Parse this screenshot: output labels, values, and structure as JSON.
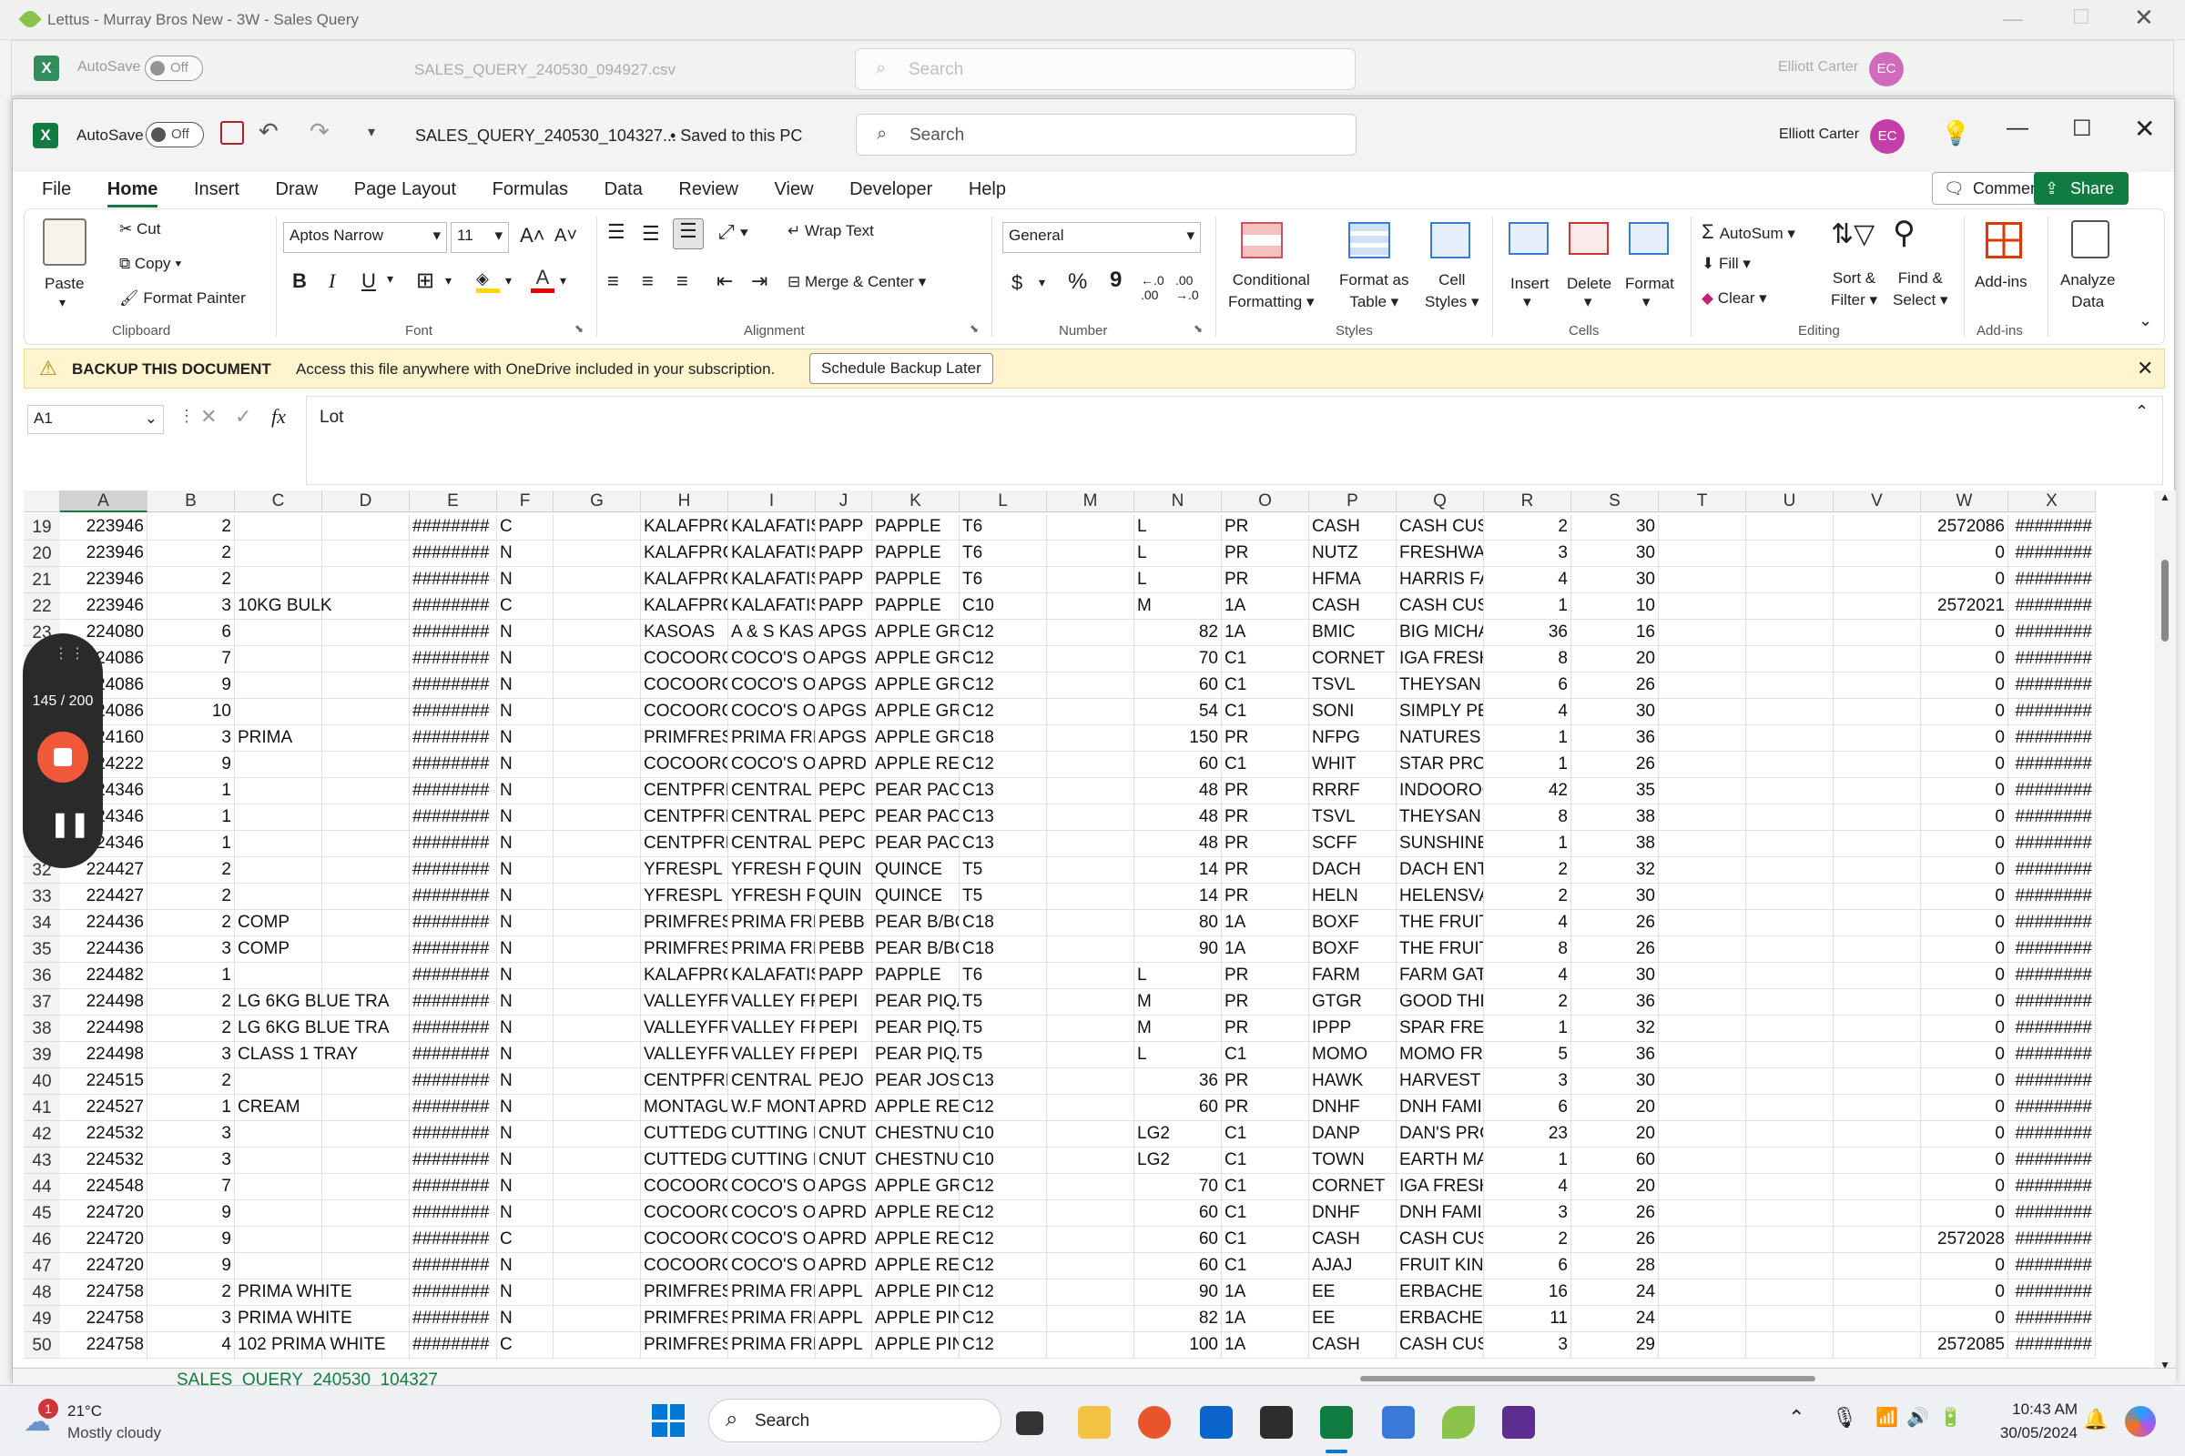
{
  "outer_window": {
    "title": "Lettus - Murray Bros New - 3W - Sales Query"
  },
  "background_window": {
    "autosave_label": "AutoSave",
    "toggle_state": "Off",
    "file_name": "SALES_QUERY_240530_094927.csv",
    "search_placeholder": "Search",
    "user_name": "Elliott Carter",
    "user_initials": "EC"
  },
  "window": {
    "autosave_label": "AutoSave",
    "toggle_state": "Off",
    "file_name": "SALES_QUERY_240530_104327...",
    "save_status": "• Saved to this PC",
    "search_placeholder": "Search",
    "user_name": "Elliott Carter",
    "user_initials": "EC"
  },
  "menu": [
    "File",
    "Home",
    "Insert",
    "Draw",
    "Page Layout",
    "Formulas",
    "Data",
    "Review",
    "View",
    "Developer",
    "Help"
  ],
  "menu_active": "Home",
  "comments_label": "Comments",
  "share_label": "Share",
  "ribbon": {
    "clipboard": {
      "paste": "Paste",
      "cut": "Cut",
      "copy": "Copy",
      "format_painter": "Format Painter",
      "group": "Clipboard"
    },
    "font": {
      "name": "Aptos Narrow",
      "size": "11",
      "group": "Font",
      "bold": "B",
      "italic": "I",
      "underline": "U"
    },
    "alignment": {
      "wrap_text": "Wrap Text",
      "merge_center": "Merge & Center",
      "group": "Alignment"
    },
    "number": {
      "format": "General",
      "group": "Number",
      "currency": "$",
      "percent": "%",
      "comma": "9"
    },
    "styles": {
      "conditional_1": "Conditional",
      "conditional_2": "Formatting",
      "format_table_1": "Format as",
      "format_table_2": "Table",
      "cell_styles_1": "Cell",
      "cell_styles_2": "Styles",
      "group": "Styles"
    },
    "cells": {
      "insert": "Insert",
      "delete": "Delete",
      "format": "Format",
      "group": "Cells"
    },
    "editing": {
      "autosum": "AutoSum",
      "fill": "Fill",
      "clear": "Clear",
      "sort_1": "Sort &",
      "sort_2": "Filter",
      "find_1": "Find &",
      "find_2": "Select",
      "group": "Editing"
    },
    "addins": {
      "addins": "Add-ins",
      "group": "Add-ins",
      "analyze_1": "Analyze",
      "analyze_2": "Data"
    }
  },
  "message_bar": {
    "title": "BACKUP THIS DOCUMENT",
    "text": "Access this file anywhere with OneDrive included in your subscription.",
    "button": "Schedule Backup Later"
  },
  "formula_bar": {
    "name_box": "A1",
    "fx": "fx",
    "content": "Lot"
  },
  "columns": [
    "A",
    "B",
    "C",
    "D",
    "E",
    "F",
    "G",
    "H",
    "I",
    "J",
    "K",
    "L",
    "M",
    "N",
    "O",
    "P",
    "Q",
    "R",
    "S",
    "T",
    "U",
    "V",
    "W",
    "X"
  ],
  "rows": [
    {
      "n": "19",
      "A": "223946",
      "B": "2",
      "C": "",
      "E": "########",
      "F": "C",
      "H": "KALAFPRC",
      "I": "KALAFATIS",
      "J": "PAPP",
      "K": "PAPPLE",
      "L": "T6",
      "M": "",
      "Nt": "L",
      "Nn": "",
      "O": "PR",
      "P": "CASH",
      "Q": "CASH CUS",
      "R": "2",
      "S": "30",
      "W": "2572086",
      "X": "########"
    },
    {
      "n": "20",
      "A": "223946",
      "B": "2",
      "C": "",
      "E": "########",
      "F": "N",
      "H": "KALAFPRC",
      "I": "KALAFATIS",
      "J": "PAPP",
      "K": "PAPPLE",
      "L": "T6",
      "M": "",
      "Nt": "L",
      "Nn": "",
      "O": "PR",
      "P": "NUTZ",
      "Q": "FRESHWAY",
      "R": "3",
      "S": "30",
      "W": "0",
      "X": "########"
    },
    {
      "n": "21",
      "A": "223946",
      "B": "2",
      "C": "",
      "E": "########",
      "F": "N",
      "H": "KALAFPRC",
      "I": "KALAFATIS",
      "J": "PAPP",
      "K": "PAPPLE",
      "L": "T6",
      "M": "",
      "Nt": "L",
      "Nn": "",
      "O": "PR",
      "P": "HFMA",
      "Q": "HARRIS FA",
      "R": "4",
      "S": "30",
      "W": "0",
      "X": "########"
    },
    {
      "n": "22",
      "A": "223946",
      "B": "3",
      "C": "10KG BULK",
      "E": "########",
      "F": "C",
      "H": "KALAFPRC",
      "I": "KALAFATIS",
      "J": "PAPP",
      "K": "PAPPLE",
      "L": "C10",
      "M": "",
      "Nt": "M",
      "Nn": "",
      "O": "1A",
      "P": "CASH",
      "Q": "CASH CUS",
      "R": "1",
      "S": "10",
      "W": "2572021",
      "X": "########"
    },
    {
      "n": "23",
      "A": "224080",
      "B": "6",
      "C": "",
      "E": "########",
      "F": "N",
      "H": "KASOAS",
      "I": "A & S KASC",
      "J": "APGS",
      "K": "APPLE GR/",
      "L": "C12",
      "M": "",
      "Nt": "",
      "Nn": "82",
      "O": "1A",
      "P": "BMIC",
      "Q": "BIG MICHA",
      "R": "36",
      "S": "16",
      "W": "0",
      "X": "########"
    },
    {
      "n": "24",
      "A": "224086",
      "B": "7",
      "C": "",
      "E": "########",
      "F": "N",
      "H": "COCOORC",
      "I": "COCO'S O",
      "J": "APGS",
      "K": "APPLE GR/",
      "L": "C12",
      "M": "",
      "Nt": "",
      "Nn": "70",
      "O": "C1",
      "P": "CORNET",
      "Q": "IGA FRESH",
      "R": "8",
      "S": "20",
      "W": "0",
      "X": "########"
    },
    {
      "n": "25",
      "A": "224086",
      "B": "9",
      "C": "",
      "E": "########",
      "F": "N",
      "H": "COCOORC",
      "I": "COCO'S O",
      "J": "APGS",
      "K": "APPLE GR/",
      "L": "C12",
      "M": "",
      "Nt": "",
      "Nn": "60",
      "O": "C1",
      "P": "TSVL",
      "Q": "THEYSAN L",
      "R": "6",
      "S": "26",
      "W": "0",
      "X": "########"
    },
    {
      "n": "26",
      "A": "224086",
      "B": "10",
      "C": "",
      "E": "########",
      "F": "N",
      "H": "COCOORC",
      "I": "COCO'S O",
      "J": "APGS",
      "K": "APPLE GR/",
      "L": "C12",
      "M": "",
      "Nt": "",
      "Nn": "54",
      "O": "C1",
      "P": "SONI",
      "Q": "SIMPLY PE",
      "R": "4",
      "S": "30",
      "W": "0",
      "X": "########"
    },
    {
      "n": "27",
      "A": "224160",
      "B": "3",
      "C": "PRIMA",
      "E": "########",
      "F": "N",
      "H": "PRIMFRES",
      "I": "PRIMA FRE",
      "J": "APGS",
      "K": "APPLE GR/",
      "L": "C18",
      "M": "",
      "Nt": "",
      "Nn": "150",
      "O": "PR",
      "P": "NFPG",
      "Q": "NATURES I",
      "R": "1",
      "S": "36",
      "W": "0",
      "X": "########"
    },
    {
      "n": "28",
      "A": "224222",
      "B": "9",
      "C": "",
      "E": "########",
      "F": "N",
      "H": "COCOORC",
      "I": "COCO'S O",
      "J": "APRD",
      "K": "APPLE REI",
      "L": "C12",
      "M": "",
      "Nt": "",
      "Nn": "60",
      "O": "C1",
      "P": "WHIT",
      "Q": "STAR PROI",
      "R": "1",
      "S": "26",
      "W": "0",
      "X": "########"
    },
    {
      "n": "29",
      "A": "224346",
      "B": "1",
      "C": "",
      "E": "########",
      "F": "N",
      "H": "CENTPFRE",
      "I": "CENTRAL I",
      "J": "PEPC",
      "K": "PEAR PACI",
      "L": "C13",
      "M": "",
      "Nt": "",
      "Nn": "48",
      "O": "PR",
      "P": "RRRF",
      "Q": "INDOOROO",
      "R": "42",
      "S": "35",
      "W": "0",
      "X": "########"
    },
    {
      "n": "30",
      "A": "224346",
      "B": "1",
      "C": "",
      "E": "########",
      "F": "N",
      "H": "CENTPFRE",
      "I": "CENTRAL I",
      "J": "PEPC",
      "K": "PEAR PACI",
      "L": "C13",
      "M": "",
      "Nt": "",
      "Nn": "48",
      "O": "PR",
      "P": "TSVL",
      "Q": "THEYSAN L",
      "R": "8",
      "S": "38",
      "W": "0",
      "X": "########"
    },
    {
      "n": "31",
      "A": "224346",
      "B": "1",
      "C": "",
      "E": "########",
      "F": "N",
      "H": "CENTPFRE",
      "I": "CENTRAL I",
      "J": "PEPC",
      "K": "PEAR PACI",
      "L": "C13",
      "M": "",
      "Nt": "",
      "Nn": "48",
      "O": "PR",
      "P": "SCFF",
      "Q": "SUNSHINE",
      "R": "1",
      "S": "38",
      "W": "0",
      "X": "########"
    },
    {
      "n": "32",
      "A": "224427",
      "B": "2",
      "C": "",
      "E": "########",
      "F": "N",
      "H": "YFRESPL",
      "I": "YFRESH P/",
      "J": "QUIN",
      "K": "QUINCE",
      "L": "T5",
      "M": "",
      "Nt": "",
      "Nn": "14",
      "O": "PR",
      "P": "DACH",
      "Q": "DACH ENT",
      "R": "2",
      "S": "32",
      "W": "0",
      "X": "########"
    },
    {
      "n": "33",
      "A": "224427",
      "B": "2",
      "C": "",
      "E": "########",
      "F": "N",
      "H": "YFRESPL",
      "I": "YFRESH P/",
      "J": "QUIN",
      "K": "QUINCE",
      "L": "T5",
      "M": "",
      "Nt": "",
      "Nn": "14",
      "O": "PR",
      "P": "HELN",
      "Q": "HELENSVA",
      "R": "2",
      "S": "30",
      "W": "0",
      "X": "########"
    },
    {
      "n": "34",
      "A": "224436",
      "B": "2",
      "C": "COMP",
      "E": "########",
      "F": "N",
      "H": "PRIMFRES",
      "I": "PRIMA FRE",
      "J": "PEBB",
      "K": "PEAR B/BC",
      "L": "C18",
      "M": "",
      "Nt": "",
      "Nn": "80",
      "O": "1A",
      "P": "BOXF",
      "Q": "THE FRUIT",
      "R": "4",
      "S": "26",
      "W": "0",
      "X": "########"
    },
    {
      "n": "35",
      "A": "224436",
      "B": "3",
      "C": "COMP",
      "E": "########",
      "F": "N",
      "H": "PRIMFRES",
      "I": "PRIMA FRE",
      "J": "PEBB",
      "K": "PEAR B/BC",
      "L": "C18",
      "M": "",
      "Nt": "",
      "Nn": "90",
      "O": "1A",
      "P": "BOXF",
      "Q": "THE FRUIT",
      "R": "8",
      "S": "26",
      "W": "0",
      "X": "########"
    },
    {
      "n": "36",
      "A": "224482",
      "B": "1",
      "C": "",
      "E": "########",
      "F": "N",
      "H": "KALAFPRC",
      "I": "KALAFATIS",
      "J": "PAPP",
      "K": "PAPPLE",
      "L": "T6",
      "M": "",
      "Nt": "L",
      "Nn": "",
      "O": "PR",
      "P": "FARM",
      "Q": "FARM GAT",
      "R": "4",
      "S": "30",
      "W": "0",
      "X": "########"
    },
    {
      "n": "37",
      "A": "224498",
      "B": "2",
      "C": "LG 6KG BLUE TRA",
      "E": "########",
      "F": "N",
      "H": "VALLEYFR",
      "I": "VALLEY FR",
      "J": "PEPI",
      "K": "PEAR PIQA",
      "L": "T5",
      "M": "",
      "Nt": "M",
      "Nn": "",
      "O": "PR",
      "P": "GTGR",
      "Q": "GOOD THI",
      "R": "2",
      "S": "36",
      "W": "0",
      "X": "########"
    },
    {
      "n": "38",
      "A": "224498",
      "B": "2",
      "C": "LG 6KG BLUE TRA",
      "E": "########",
      "F": "N",
      "H": "VALLEYFR",
      "I": "VALLEY FR",
      "J": "PEPI",
      "K": "PEAR PIQA",
      "L": "T5",
      "M": "",
      "Nt": "M",
      "Nn": "",
      "O": "PR",
      "P": "IPPP",
      "Q": "SPAR FRES",
      "R": "1",
      "S": "32",
      "W": "0",
      "X": "########"
    },
    {
      "n": "39",
      "A": "224498",
      "B": "3",
      "C": "CLASS 1 TRAY",
      "E": "########",
      "F": "N",
      "H": "VALLEYFR",
      "I": "VALLEY FR",
      "J": "PEPI",
      "K": "PEAR PIQA",
      "L": "T5",
      "M": "",
      "Nt": "L",
      "Nn": "",
      "O": "C1",
      "P": "MOMO",
      "Q": "MOMO FRI",
      "R": "5",
      "S": "36",
      "W": "0",
      "X": "########"
    },
    {
      "n": "40",
      "A": "224515",
      "B": "2",
      "C": "",
      "E": "########",
      "F": "N",
      "H": "CENTPFRE",
      "I": "CENTRAL I",
      "J": "PEJO",
      "K": "PEAR JOSE",
      "L": "C13",
      "M": "",
      "Nt": "",
      "Nn": "36",
      "O": "PR",
      "P": "HAWK",
      "Q": "HARVEST F",
      "R": "3",
      "S": "30",
      "W": "0",
      "X": "########"
    },
    {
      "n": "41",
      "A": "224527",
      "B": "1",
      "C": "CREAM",
      "E": "########",
      "F": "N",
      "H": "MONTAGU",
      "I": "W.F MONT",
      "J": "APRD",
      "K": "APPLE REI",
      "L": "C12",
      "M": "",
      "Nt": "",
      "Nn": "60",
      "O": "PR",
      "P": "DNHF",
      "Q": "DNH FAMI",
      "R": "6",
      "S": "20",
      "W": "0",
      "X": "########"
    },
    {
      "n": "42",
      "A": "224532",
      "B": "3",
      "C": "",
      "E": "########",
      "F": "N",
      "H": "CUTTEDGI",
      "I": "CUTTING E",
      "J": "CNUT",
      "K": "CHESTNU'",
      "L": "C10",
      "M": "",
      "Nt": "LG2",
      "Nn": "",
      "O": "C1",
      "P": "DANP",
      "Q": "DAN'S PRC",
      "R": "23",
      "S": "20",
      "W": "0",
      "X": "########"
    },
    {
      "n": "43",
      "A": "224532",
      "B": "3",
      "C": "",
      "E": "########",
      "F": "N",
      "H": "CUTTEDGI",
      "I": "CUTTING E",
      "J": "CNUT",
      "K": "CHESTNU'",
      "L": "C10",
      "M": "",
      "Nt": "LG2",
      "Nn": "",
      "O": "C1",
      "P": "TOWN",
      "Q": "EARTH MA",
      "R": "1",
      "S": "60",
      "W": "0",
      "X": "########"
    },
    {
      "n": "44",
      "A": "224548",
      "B": "7",
      "C": "",
      "E": "########",
      "F": "N",
      "H": "COCOORC",
      "I": "COCO'S O",
      "J": "APGS",
      "K": "APPLE GR/",
      "L": "C12",
      "M": "",
      "Nt": "",
      "Nn": "70",
      "O": "C1",
      "P": "CORNET",
      "Q": "IGA FRESH",
      "R": "4",
      "S": "20",
      "W": "0",
      "X": "########"
    },
    {
      "n": "45",
      "A": "224720",
      "B": "9",
      "C": "",
      "E": "########",
      "F": "N",
      "H": "COCOORC",
      "I": "COCO'S O",
      "J": "APRD",
      "K": "APPLE REI",
      "L": "C12",
      "M": "",
      "Nt": "",
      "Nn": "60",
      "O": "C1",
      "P": "DNHF",
      "Q": "DNH FAMI",
      "R": "3",
      "S": "26",
      "W": "0",
      "X": "########"
    },
    {
      "n": "46",
      "A": "224720",
      "B": "9",
      "C": "",
      "E": "########",
      "F": "C",
      "H": "COCOORC",
      "I": "COCO'S O",
      "J": "APRD",
      "K": "APPLE REI",
      "L": "C12",
      "M": "",
      "Nt": "",
      "Nn": "60",
      "O": "C1",
      "P": "CASH",
      "Q": "CASH CUS",
      "R": "2",
      "S": "26",
      "W": "2572028",
      "X": "########"
    },
    {
      "n": "47",
      "A": "224720",
      "B": "9",
      "C": "",
      "E": "########",
      "F": "N",
      "H": "COCOORC",
      "I": "COCO'S O",
      "J": "APRD",
      "K": "APPLE REI",
      "L": "C12",
      "M": "",
      "Nt": "",
      "Nn": "60",
      "O": "C1",
      "P": "AJAJ",
      "Q": "FRUIT KIN",
      "R": "6",
      "S": "28",
      "W": "0",
      "X": "########"
    },
    {
      "n": "48",
      "A": "224758",
      "B": "2",
      "C": "PRIMA WHITE",
      "E": "########",
      "F": "N",
      "H": "PRIMFRES",
      "I": "PRIMA FRE",
      "J": "APPL",
      "K": "APPLE PIN",
      "L": "C12",
      "M": "",
      "Nt": "",
      "Nn": "90",
      "O": "1A",
      "P": "EE",
      "Q": "ERBACHEF",
      "R": "16",
      "S": "24",
      "W": "0",
      "X": "########"
    },
    {
      "n": "49",
      "A": "224758",
      "B": "3",
      "C": "PRIMA WHITE",
      "E": "########",
      "F": "N",
      "H": "PRIMFRES",
      "I": "PRIMA FRE",
      "J": "APPL",
      "K": "APPLE PIN",
      "L": "C12",
      "M": "",
      "Nt": "",
      "Nn": "82",
      "O": "1A",
      "P": "EE",
      "Q": "ERBACHEF",
      "R": "11",
      "S": "24",
      "W": "0",
      "X": "########"
    },
    {
      "n": "50",
      "A": "224758",
      "B": "4",
      "C": "102 PRIMA WHITE",
      "E": "########",
      "F": "C",
      "H": "PRIMFRES",
      "I": "PRIMA FRE",
      "J": "APPL",
      "K": "APPLE PIN",
      "L": "C12",
      "M": "",
      "Nt": "",
      "Nn": "100",
      "O": "1A",
      "P": "CASH",
      "Q": "CASH CUS",
      "R": "3",
      "S": "29",
      "W": "2572085",
      "X": "########"
    }
  ],
  "recorder": {
    "counter": "145 / 200"
  },
  "sheet_tab": "SALES_QUERY_240530_104327",
  "taskbar": {
    "weather_temp": "21°C",
    "weather_desc": "Mostly cloudy",
    "weather_badge": "1",
    "search": "Search",
    "time": "10:43 AM",
    "date": "30/05/2024"
  },
  "colors": {
    "excel_green": "#107c41",
    "avatar": "#c43ea8",
    "record_red": "#f05a3a",
    "message_bg": "#fff4ce"
  }
}
